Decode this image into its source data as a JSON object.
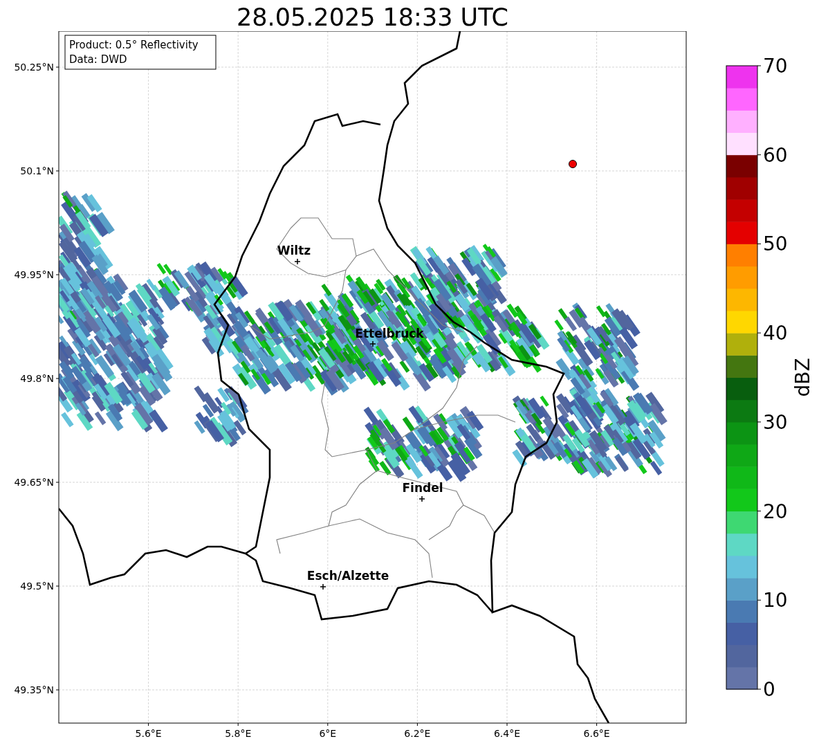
{
  "title": "28.05.2025 18:33 UTC",
  "info_box": [
    "Product: 0.5° Reflectivity",
    "Data: DWD"
  ],
  "y_ticks": [
    "50.25°N",
    "50.1°N",
    "49.95°N",
    "49.8°N",
    "49.65°N",
    "49.5°N",
    "49.35°N"
  ],
  "x_ticks": [
    "5.6°E",
    "5.8°E",
    "6°E",
    "6.2°E",
    "6.4°E",
    "6.6°E"
  ],
  "cities": [
    {
      "name": "Wiltz"
    },
    {
      "name": "Ettelbruck"
    },
    {
      "name": "Findel"
    },
    {
      "name": "Esch/Alzette"
    }
  ],
  "colorbar": {
    "label": "dBZ",
    "ticks": [
      "70",
      "60",
      "50",
      "40",
      "30",
      "20",
      "10",
      "0"
    ],
    "bands": [
      {
        "color": "#6474a8"
      },
      {
        "color": "#52669e"
      },
      {
        "color": "#4660a4"
      },
      {
        "color": "#4a7ab2"
      },
      {
        "color": "#5aa0c8"
      },
      {
        "color": "#66c2dc"
      },
      {
        "color": "#5ed8c4"
      },
      {
        "color": "#3ed872"
      },
      {
        "color": "#12c81a"
      },
      {
        "color": "#10b818"
      },
      {
        "color": "#0fa816"
      },
      {
        "color": "#0c9414"
      },
      {
        "color": "#0c7a12"
      },
      {
        "color": "#085e0e"
      },
      {
        "color": "#447610"
      },
      {
        "color": "#b0b00c"
      },
      {
        "color": "#ffd700"
      },
      {
        "color": "#fdb700"
      },
      {
        "color": "#ff9c00"
      },
      {
        "color": "#ff7f00"
      },
      {
        "color": "#e40000"
      },
      {
        "color": "#c40000"
      },
      {
        "color": "#a00000"
      },
      {
        "color": "#7a0000"
      },
      {
        "color": "#ffe0ff"
      },
      {
        "color": "#ffb0ff"
      },
      {
        "color": "#ff66ff"
      },
      {
        "color": "#ee33ee"
      }
    ]
  }
}
